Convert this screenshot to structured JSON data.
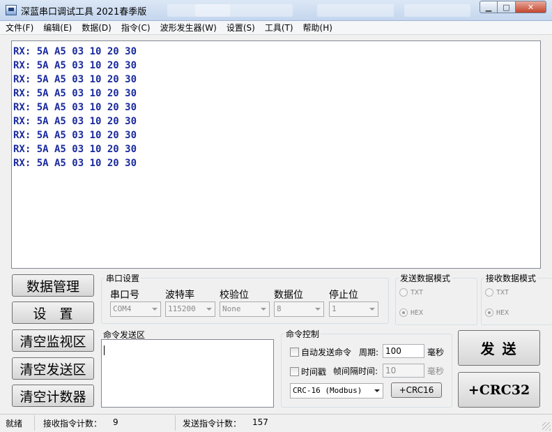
{
  "window": {
    "title": "深蓝串口调试工具 2021春季版",
    "buttons": {
      "minimize": "▁",
      "maximize": "□",
      "close": "✕"
    }
  },
  "menu": [
    "文件(F)",
    "编辑(E)",
    "数据(D)",
    "指令(C)",
    "波形发生器(W)",
    "设置(S)",
    "工具(T)",
    "帮助(H)"
  ],
  "monitor": {
    "lines": [
      "RX: 5A A5 03 10 20 30",
      "RX: 5A A5 03 10 20 30",
      "RX: 5A A5 03 10 20 30",
      "RX: 5A A5 03 10 20 30",
      "RX: 5A A5 03 10 20 30",
      "RX: 5A A5 03 10 20 30",
      "RX: 5A A5 03 10 20 30",
      "RX: 5A A5 03 10 20 30",
      "RX: 5A A5 03 10 20 30"
    ],
    "text_color": "#1a2a9c"
  },
  "left_buttons": {
    "data_manage": "数据管理",
    "settings": "设　置",
    "clear_monitor": "清空监视区",
    "clear_send": "清空发送区",
    "clear_counter": "清空计数器"
  },
  "serial": {
    "group_title": "串口设置",
    "port": {
      "label": "串口号",
      "value": "COM4"
    },
    "baud": {
      "label": "波特率",
      "value": "115200"
    },
    "parity": {
      "label": "校验位",
      "value": "None"
    },
    "databits": {
      "label": "数据位",
      "value": "8"
    },
    "stopbits": {
      "label": "停止位",
      "value": "1"
    }
  },
  "send_mode": {
    "title": "发送数据模式",
    "txt": "TXT",
    "hex": "HEX",
    "selected": "HEX"
  },
  "recv_mode": {
    "title": "接收数据模式",
    "txt": "TXT",
    "hex": "HEX",
    "selected": "HEX"
  },
  "command_send": {
    "title": "命令发送区",
    "value": ""
  },
  "command_control": {
    "title": "命令控制",
    "auto_send": "自动发送命令",
    "period_label": "周期:",
    "period_value": "100",
    "period_unit": "毫秒",
    "timestamp": "时间戳",
    "frame_interval_label": "帧间隔时间:",
    "frame_interval_value": "10",
    "frame_interval_unit": "毫秒",
    "crc_select": "CRC-16 (Modbus)",
    "crc16_button": "+CRC16"
  },
  "send_button": "发 送",
  "crc32_button": "+CRC32",
  "status": {
    "ready": "就绪",
    "recv_label": "接收指令计数：",
    "recv_count": "9",
    "send_label": "发送指令计数：",
    "send_count": "157"
  }
}
